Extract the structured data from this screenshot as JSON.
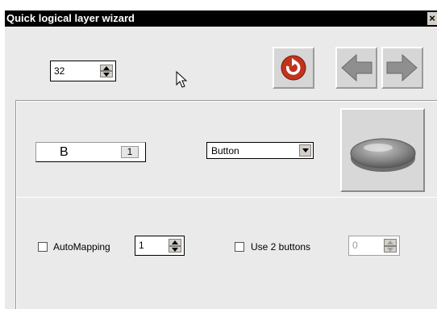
{
  "window": {
    "title": "Quick logical layer wizard",
    "close_glyph": "×"
  },
  "layer_spinner": {
    "value": "32"
  },
  "toolbar": {
    "refresh": {
      "icon": "refresh-icon",
      "accent": "#c0341d"
    },
    "prev": {
      "icon": "arrow-left-icon"
    },
    "next": {
      "icon": "arrow-right-icon"
    }
  },
  "key_field": {
    "key": "B",
    "index": "1"
  },
  "control_type": {
    "selected": "Button"
  },
  "preview": {
    "icon": "button-preview-icon"
  },
  "automapping": {
    "label": "AutoMapping",
    "checked": false,
    "value": "1"
  },
  "two_buttons": {
    "label": "Use 2 buttons",
    "checked": false,
    "value": "0",
    "enabled": false
  }
}
